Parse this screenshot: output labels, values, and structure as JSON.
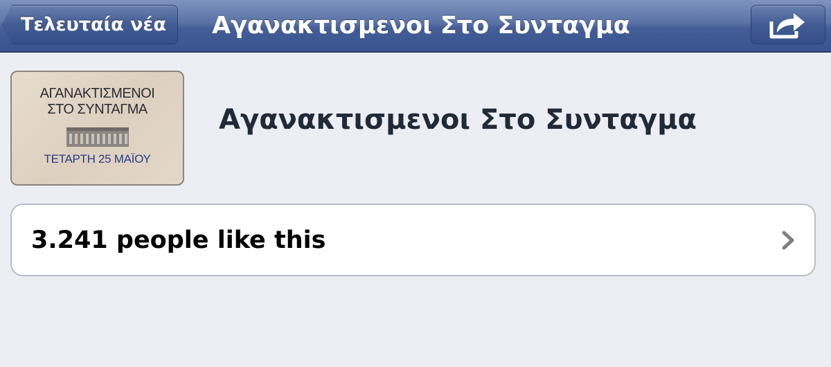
{
  "navbar": {
    "back_label": "Τελευταία νέα",
    "title": "Αγανακτισμενοι Στο Συνταγμα",
    "share_icon": "share-arrow-icon"
  },
  "header": {
    "thumbnail": {
      "line1": "ΑΓΑΝΑΚΤΙΣΜΕΝΟΙ",
      "line2": "ΣΤΟ ΣΥΝΤΑΓΜΑ",
      "date": "ΤΕΤΑΡΤΗ 25 ΜΑΪΟΥ"
    },
    "title": "Αγανακτισμενοι Στο Συνταγμα"
  },
  "likes": {
    "label": "3.241 people like this",
    "icon": "chevron-right-icon"
  },
  "colors": {
    "navbar": "#435d96",
    "background": "#eceef4",
    "heading": "#212a38"
  }
}
